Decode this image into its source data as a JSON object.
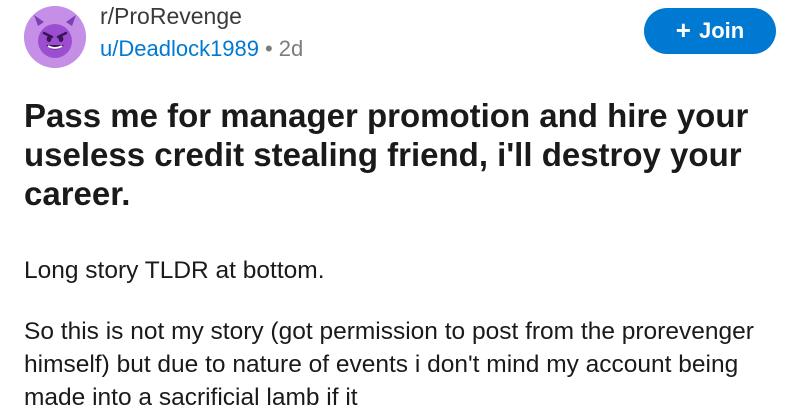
{
  "post": {
    "subreddit": "r/ProRevenge",
    "author": "u/Deadlock1989",
    "separator": "•",
    "age": "2d",
    "join_label": "Join",
    "join_icon": "plus-icon",
    "avatar_icon": "devil-emoji-icon",
    "title": "Pass me for manager promotion and hire your useless credit stealing friend, i'll destroy your career.",
    "paragraphs": [
      "Long story TLDR at bottom.",
      "So this is not my story (got permission to post from the prorevenger himself) but due to nature of events i don't mind my account being made into a sacrificial lamb if it"
    ]
  },
  "colors": {
    "accent": "#0079d3",
    "avatar_bg": "#c58fe8",
    "text": "#1a1a1b",
    "muted": "#7c7c7c"
  }
}
